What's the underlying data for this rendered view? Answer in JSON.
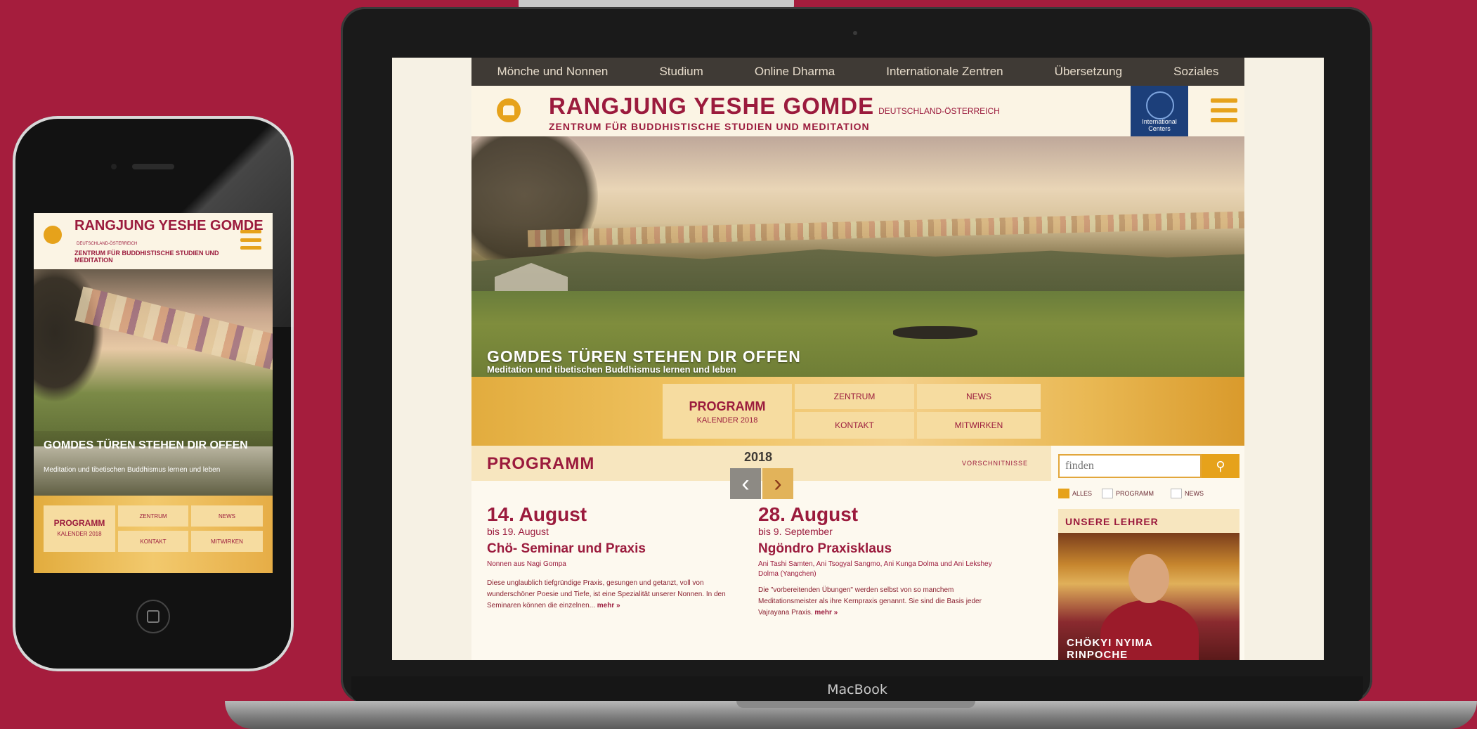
{
  "laptop": {
    "brand_label": "MacBook",
    "topnav": [
      "Mönche und Nonnen",
      "Studium",
      "Online Dharma",
      "Internationale Zentren",
      "Übersetzung",
      "Soziales"
    ],
    "header": {
      "title": "RANGJUNG YESHE GOMDE",
      "country": "DEUTSCHLAND-ÖSTERREICH",
      "subtitle": "ZENTRUM FÜR BUDDHISTISCHE STUDIEN UND MEDITATION",
      "intl_badge": "International Centers"
    },
    "hero": {
      "title": "GOMDES TÜREN STEHEN DIR OFFEN",
      "subtitle": "Meditation und tibetischen Buddhismus lernen und leben"
    },
    "quicklinks": {
      "programm_title": "PROGRAMM",
      "programm_sub": "KALENDER 2018",
      "zentrum": "ZENTRUM",
      "news": "NEWS",
      "kontakt": "KONTAKT",
      "mitwirken": "MITWIRKEN"
    },
    "program": {
      "heading": "PROGRAMM",
      "year": "2018",
      "archive_link": "VORSCHNITNISSE",
      "events": [
        {
          "date": "14. August",
          "until": "bis 19. August",
          "title": "Chö- Seminar und Praxis",
          "who": "Nonnen aus Nagi Gompa",
          "desc": "Diese unglaublich tiefgründige Praxis, gesungen und getanzt, voll von wunderschöner Poesie und Tiefe, ist eine Spezialität unserer Nonnen. In den Seminaren können die einzelnen...",
          "more": "mehr »"
        },
        {
          "date": "28. August",
          "until": "bis 9. September",
          "title": "Ngöndro Praxisklaus",
          "who": "Ani Tashi Samten, Ani Tsogyal Sangmo, Ani Kunga Dolma und Ani Lekshey Dolma (Yangchen)",
          "desc": "Die \"vorbereitenden Übungen\" werden selbst von so manchem Meditationsmeister als ihre Kernpraxis genannt. Sie sind die Basis jeder Vajrayana Praxis.",
          "more": "mehr »"
        }
      ]
    },
    "sidebar": {
      "search_placeholder": "finden",
      "search_icon": "search-icon",
      "filters": [
        "ALLES",
        "PROGRAMM",
        "NEWS"
      ],
      "teachers_heading": "UNSERE LEHRER",
      "teacher_name": "CHÖKYI NYIMA RINPOCHE"
    }
  },
  "phone": {
    "title": "RANGJUNG YESHE GOMDE",
    "country": "DEUTSCHLAND-ÖSTERREICH",
    "subtitle": "ZENTRUM FÜR BUDDHISTISCHE STUDIEN UND MEDITATION",
    "hero_title": "GOMDES TÜREN STEHEN DIR OFFEN",
    "hero_subtitle": "Meditation und tibetischen Buddhismus lernen und leben",
    "programm_title": "PROGRAMM",
    "programm_sub": "KALENDER 2018",
    "zentrum": "ZENTRUM",
    "news": "NEWS",
    "kontakt": "KONTAKT",
    "mitwirken": "MITWIRKEN"
  },
  "colors": {
    "background": "#a51d3d",
    "brand": "#9b1b3d",
    "accent": "#e6a21b",
    "nav": "#3f3a35"
  }
}
